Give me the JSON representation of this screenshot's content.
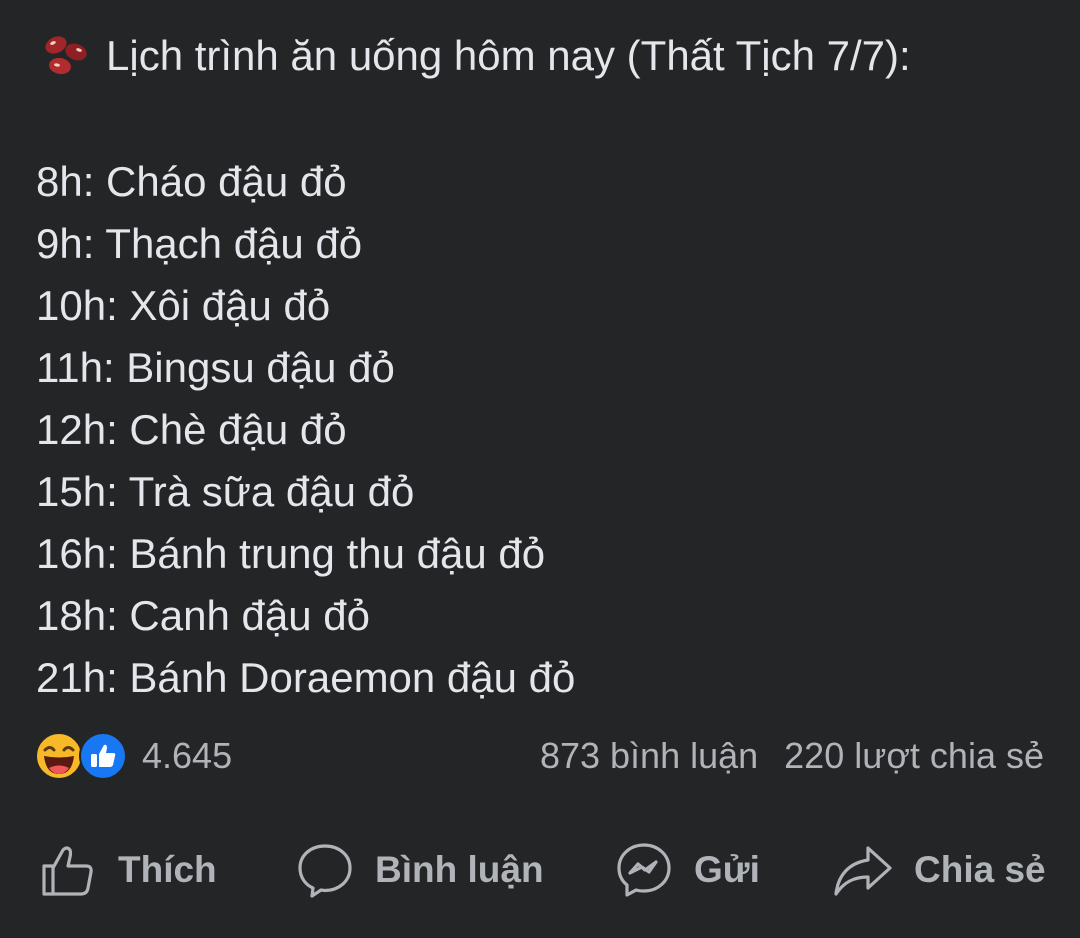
{
  "post": {
    "title": "Lịch trình ăn uống hôm nay (Thất Tịch 7/7):",
    "title_icon": "red-beans-icon",
    "schedule": [
      "8h: Cháo đậu đỏ",
      "9h: Thạch đậu đỏ",
      "10h: Xôi đậu đỏ",
      "11h: Bingsu đậu đỏ",
      "12h: Chè đậu đỏ",
      "15h: Trà sữa đậu đỏ",
      "16h: Bánh trung thu đậu đỏ",
      "18h: Canh đậu đỏ",
      "21h: Bánh Doraemon đậu đỏ"
    ]
  },
  "stats": {
    "reaction_icons": [
      "haha-icon",
      "like-reaction-icon"
    ],
    "reaction_count": "4.645",
    "comments": "873 bình luận",
    "shares": "220 lượt chia sẻ"
  },
  "actions": {
    "like": {
      "label": "Thích",
      "icon": "thumbs-up-outline-icon"
    },
    "comment": {
      "label": "Bình luận",
      "icon": "comment-bubble-icon"
    },
    "send": {
      "label": "Gửi",
      "icon": "messenger-icon"
    },
    "share": {
      "label": "Chia sẻ",
      "icon": "share-arrow-icon"
    }
  },
  "colors": {
    "background": "#242526",
    "primary_text": "#e4e6eb",
    "secondary_text": "#b0b3b8",
    "like_blue": "#1877f2",
    "haha_yellow": "#f7b928"
  }
}
